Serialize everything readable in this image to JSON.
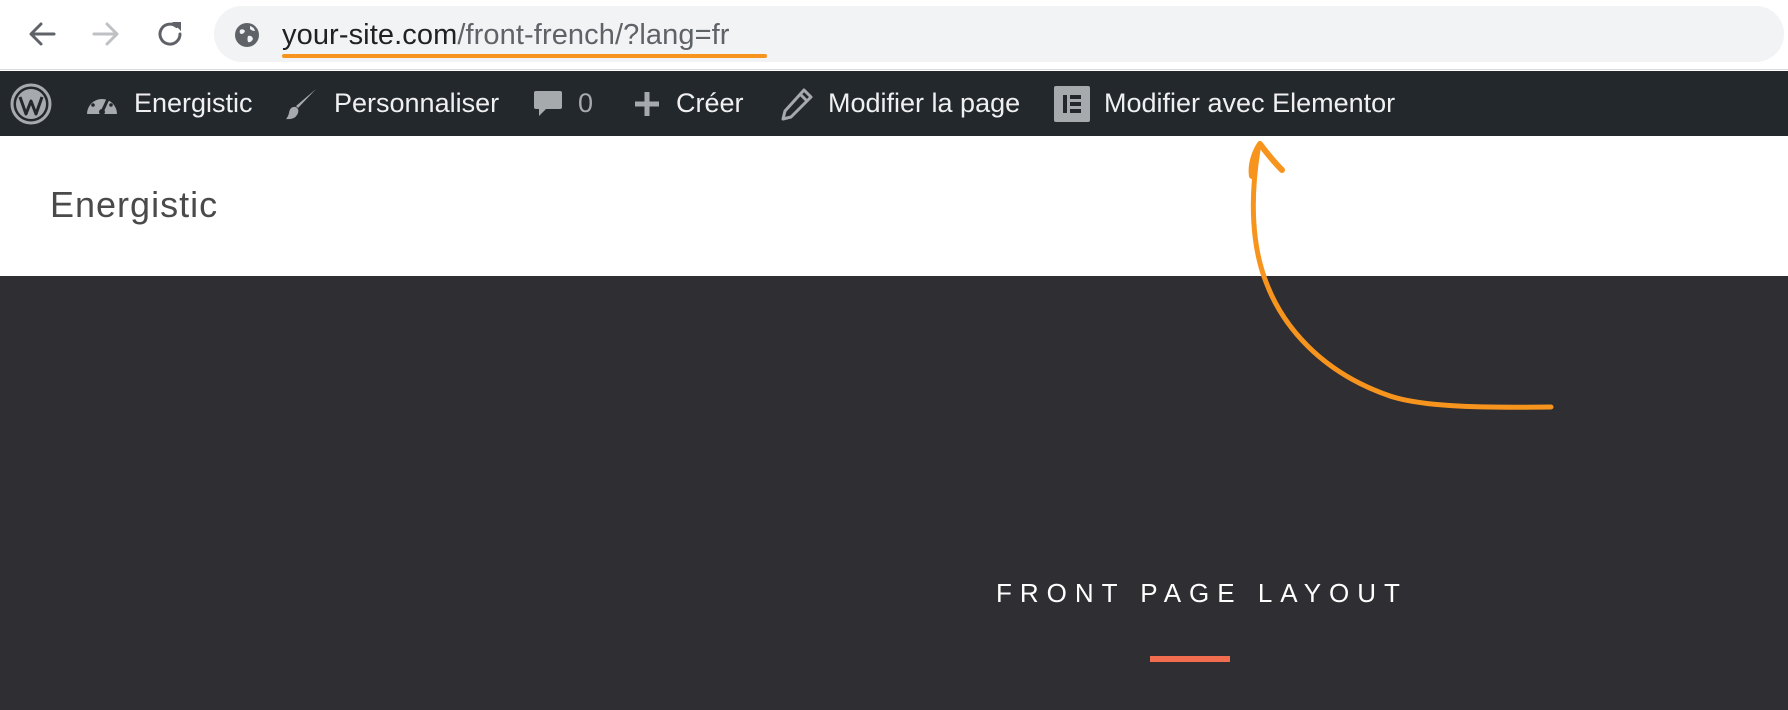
{
  "browser": {
    "url_host": "your-site.com",
    "url_path": "/front-french/?lang=fr",
    "icons": [
      "back-arrow-icon",
      "forward-arrow-icon",
      "reload-icon",
      "globe-icon"
    ]
  },
  "admin_bar": {
    "site_name": "Energistic",
    "customize": "Personnaliser",
    "comments_count": "0",
    "new": "Créer",
    "edit_page": "Modifier la page",
    "edit_elementor": "Modifier avec Elementor",
    "icons": [
      "wordpress-logo-icon",
      "dashboard-gauge-icon",
      "paintbrush-icon",
      "comment-bubble-icon",
      "plus-icon",
      "pencil-icon",
      "elementor-icon"
    ]
  },
  "site": {
    "title": "Energistic"
  },
  "hero": {
    "heading": "FRONT PAGE LAYOUT"
  },
  "colors": {
    "annotation_orange": "#f7941d",
    "admin_bar_bg": "#23282d",
    "hero_bg": "#2e2e33",
    "divider": "#f26c4f"
  }
}
